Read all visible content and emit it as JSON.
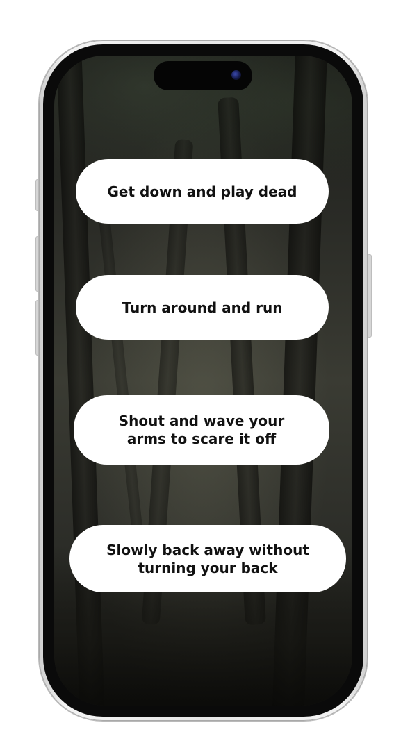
{
  "options": [
    {
      "label": "Get down and play dead"
    },
    {
      "label": "Turn around and run"
    },
    {
      "label": "Shout and wave your arms to scare it off"
    },
    {
      "label": "Slowly back away without turning your back"
    }
  ],
  "colors": {
    "option_background": "#ffffff",
    "option_text": "#111111",
    "screen_background": "#2a2b26"
  },
  "icons": {
    "camera": "front-camera-icon"
  }
}
